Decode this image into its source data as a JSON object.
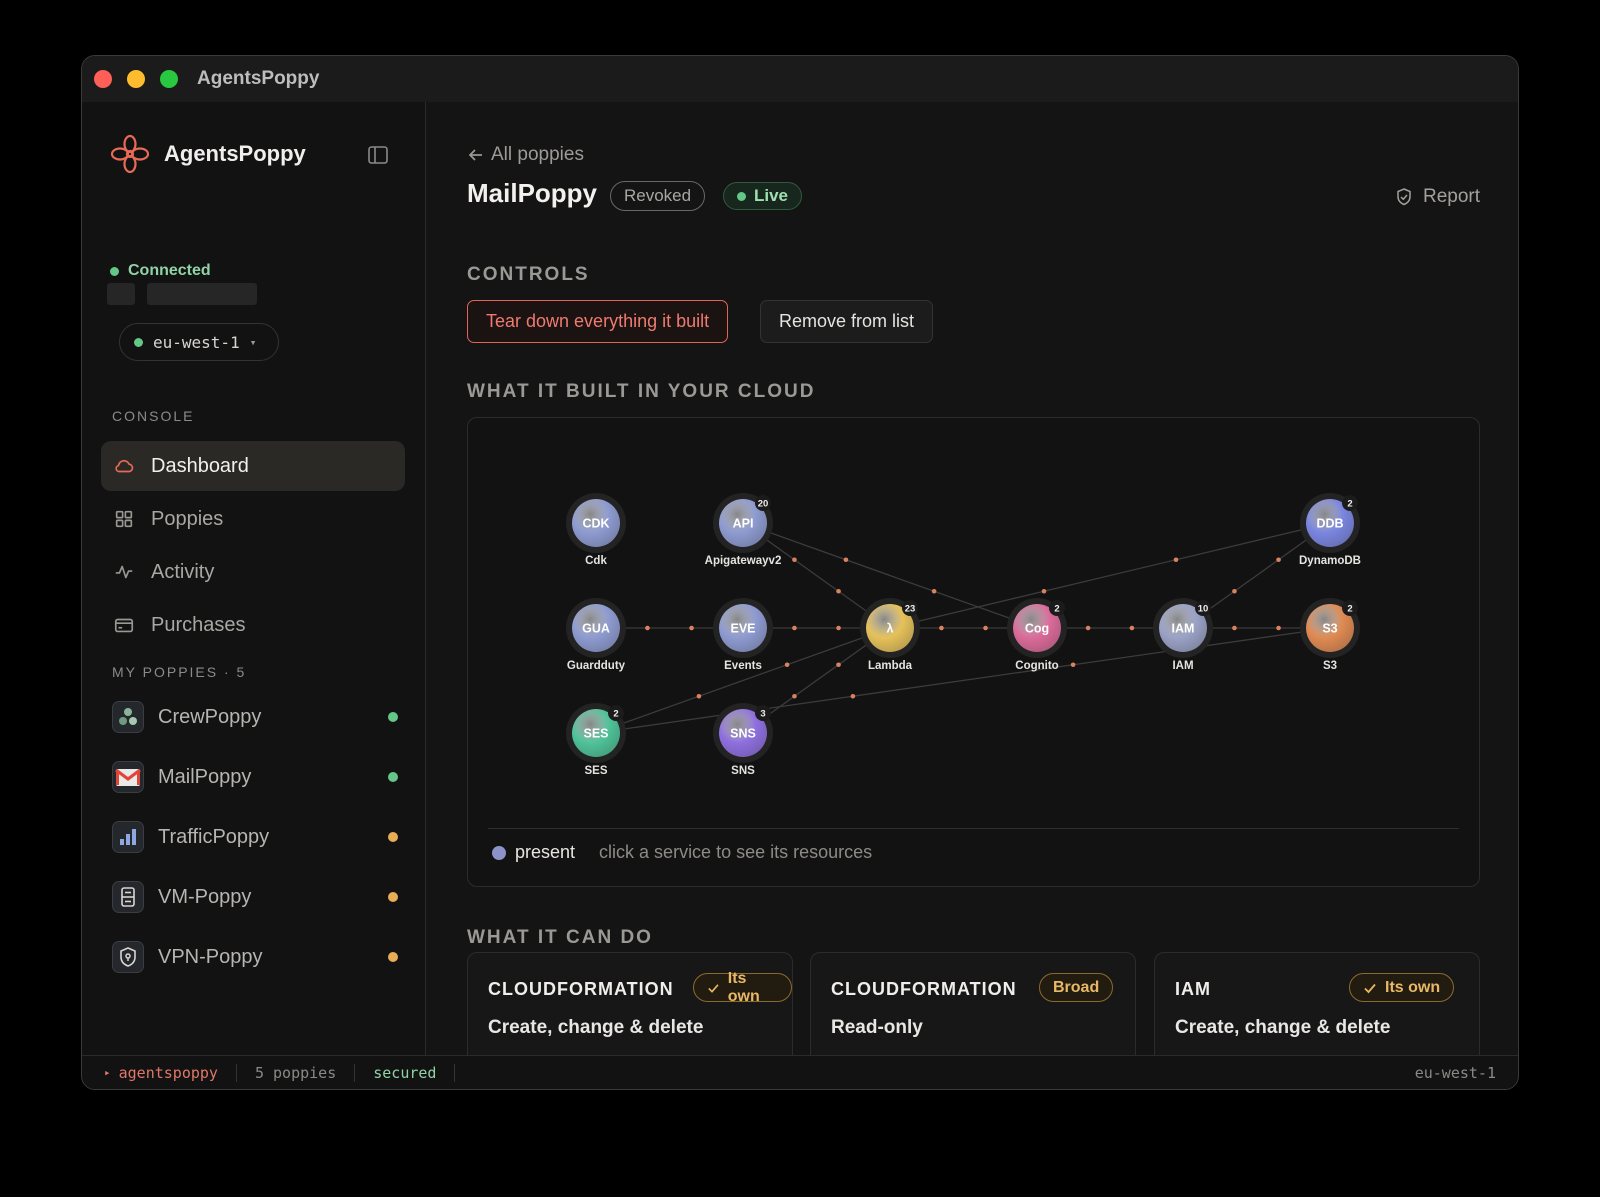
{
  "window": {
    "title": "AgentsPoppy"
  },
  "sidebar": {
    "brand": "AgentsPoppy",
    "connection": "Connected",
    "region": "eu-west-1",
    "console_label": "CONSOLE",
    "nav": [
      {
        "label": "Dashboard",
        "icon": "cloud-icon",
        "active": true
      },
      {
        "label": "Poppies",
        "icon": "grid-icon",
        "active": false
      },
      {
        "label": "Activity",
        "icon": "activity-icon",
        "active": false
      },
      {
        "label": "Purchases",
        "icon": "card-icon",
        "active": false
      }
    ],
    "my_poppies_label": "MY POPPIES · 5",
    "poppies": [
      {
        "label": "CrewPoppy",
        "icon": "crew-icon",
        "status_color": "#63c788"
      },
      {
        "label": "MailPoppy",
        "icon": "mail-icon",
        "status_color": "#63c788"
      },
      {
        "label": "TrafficPoppy",
        "icon": "traffic-icon",
        "status_color": "#e8ad55"
      },
      {
        "label": "VM-Poppy",
        "icon": "vm-icon",
        "status_color": "#e8ad55"
      },
      {
        "label": "VPN-Poppy",
        "icon": "vpn-icon",
        "status_color": "#e8ad55"
      }
    ]
  },
  "main": {
    "back_label": "All poppies",
    "title": "MailPoppy",
    "badge_revoked": "Revoked",
    "badge_live": "Live",
    "report_label": "Report",
    "controls_heading": "CONTROLS",
    "teardown_button": "Tear down everything it built",
    "remove_button": "Remove from list",
    "cloud_heading": "WHAT IT BUILT IN YOUR CLOUD",
    "legend_present": "present",
    "legend_hint": "click a service to see its resources",
    "can_do_heading": "WHAT IT CAN DO",
    "permissions": [
      {
        "name": "CLOUDFORMATION",
        "badge": "Its own",
        "check": true,
        "desc": "Create, change & delete"
      },
      {
        "name": "CLOUDFORMATION",
        "badge": "Broad",
        "check": false,
        "desc": "Read-only"
      },
      {
        "name": "IAM",
        "badge": "Its own",
        "check": true,
        "desc": "Create, change & delete"
      }
    ]
  },
  "graph": {
    "nodes": [
      {
        "id": "cdk",
        "abbr": "CDK",
        "label": "Cdk",
        "count": "",
        "color": "#8e9bd1"
      },
      {
        "id": "api",
        "abbr": "API",
        "label": "Apigatewayv2",
        "count": "20",
        "color": "#8e9bd1"
      },
      {
        "id": "ddb",
        "abbr": "DDB",
        "label": "DynamoDB",
        "count": "2",
        "color": "#7a86e0"
      },
      {
        "id": "gua",
        "abbr": "GUA",
        "label": "Guardduty",
        "count": "",
        "color": "#8e9bd1"
      },
      {
        "id": "eve",
        "abbr": "EVE",
        "label": "Events",
        "count": "",
        "color": "#8e9bd1"
      },
      {
        "id": "lam",
        "abbr": "λ",
        "label": "Lambda",
        "count": "23",
        "color": "#e6c15a"
      },
      {
        "id": "cog",
        "abbr": "Cog",
        "label": "Cognito",
        "count": "2",
        "color": "#db6b9a"
      },
      {
        "id": "iam",
        "abbr": "IAM",
        "label": "IAM",
        "count": "10",
        "color": "#9aa2c6"
      },
      {
        "id": "s3",
        "abbr": "S3",
        "label": "S3",
        "count": "2",
        "color": "#e08a52"
      },
      {
        "id": "ses",
        "abbr": "SES",
        "label": "SES",
        "count": "2",
        "color": "#4fc39a"
      },
      {
        "id": "sns",
        "abbr": "SNS",
        "label": "SNS",
        "count": "3",
        "color": "#8f6fe0"
      }
    ],
    "edges": [
      [
        "api",
        "lam"
      ],
      [
        "api",
        "cog"
      ],
      [
        "gua",
        "eve"
      ],
      [
        "eve",
        "lam"
      ],
      [
        "lam",
        "cog"
      ],
      [
        "lam",
        "ddb"
      ],
      [
        "cog",
        "iam"
      ],
      [
        "iam",
        "s3"
      ],
      [
        "iam",
        "ddb"
      ],
      [
        "ses",
        "lam"
      ],
      [
        "ses",
        "s3"
      ],
      [
        "sns",
        "lam"
      ]
    ]
  },
  "statusbar": {
    "project": "agentspoppy",
    "count": "5 poppies",
    "state": "secured",
    "region": "eu-west-1"
  }
}
